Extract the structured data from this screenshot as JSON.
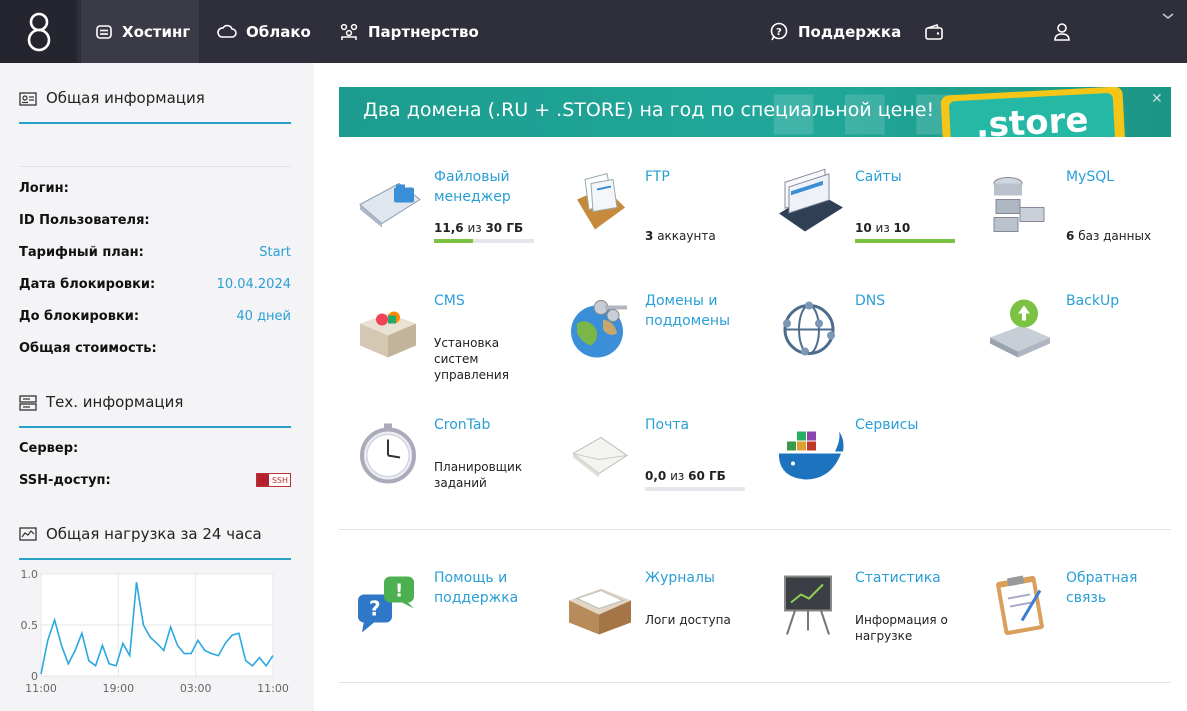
{
  "nav": {
    "items": [
      {
        "label": "Хостинг",
        "icon": "server-icon"
      },
      {
        "label": "Облако",
        "icon": "cloud-icon"
      },
      {
        "label": "Партнерство",
        "icon": "partners-icon"
      }
    ],
    "support_label": "Поддержка"
  },
  "general": {
    "title": "Общая информация",
    "rows": [
      {
        "label": "Логин:",
        "value": ""
      },
      {
        "label": "ID Пользователя:",
        "value": ""
      },
      {
        "label": "Тарифный план:",
        "value": "Start"
      },
      {
        "label": "Дата блокировки:",
        "value": "10.04.2024"
      },
      {
        "label": "До блокировки:",
        "value": "40 дней"
      },
      {
        "label": "Общая стоимость:",
        "value": ""
      }
    ]
  },
  "tech": {
    "title": "Тех. информация",
    "server_label": "Сервер:",
    "ssh_label": "SSH-доступ:",
    "ssh_badge": "SSH"
  },
  "load": {
    "title": "Общая нагрузка за 24 часа"
  },
  "chart_data": {
    "type": "line",
    "title": "Общая нагрузка за 24 часа",
    "x_tick_labels": [
      "11:00",
      "19:00",
      "03:00",
      "11:00"
    ],
    "y_tick_labels": [
      "0",
      "0.5",
      "1.0"
    ],
    "ylim": [
      0,
      1.0
    ],
    "grid": true,
    "color": "#29a9e0",
    "values": [
      0.02,
      0.35,
      0.55,
      0.3,
      0.12,
      0.25,
      0.42,
      0.15,
      0.1,
      0.3,
      0.12,
      0.1,
      0.32,
      0.2,
      0.92,
      0.5,
      0.38,
      0.32,
      0.25,
      0.48,
      0.3,
      0.22,
      0.22,
      0.35,
      0.25,
      0.22,
      0.2,
      0.32,
      0.4,
      0.42,
      0.15,
      0.1,
      0.18,
      0.1,
      0.2
    ]
  },
  "banner": {
    "text": "Два домена (.RU + .STORE) на год по специальной цене!",
    "store_label": ".store"
  },
  "tiles": [
    {
      "title": "Файловый менеджер",
      "used": "11,6",
      "of_word": "из",
      "total": "30 ГБ",
      "fill": 0.39,
      "icon": "file-manager-icon"
    },
    {
      "title": "FTP",
      "count": "3",
      "caption": "аккаунта",
      "icon": "ftp-icon"
    },
    {
      "title": "Сайты",
      "used": "10",
      "of_word": "из",
      "total": "10",
      "fill": 1.0,
      "icon": "sites-icon"
    },
    {
      "title": "MySQL",
      "count": "6",
      "caption": "баз данных",
      "icon": "mysql-icon"
    },
    {
      "title": "CMS",
      "caption": "Установка систем управления",
      "icon": "cms-box-icon"
    },
    {
      "title": "Домены и поддомены",
      "icon": "domains-globe-icon"
    },
    {
      "title": "DNS",
      "icon": "dns-network-icon"
    },
    {
      "title": "BackUp",
      "icon": "backup-drive-icon"
    },
    {
      "title": "CronTab",
      "caption": "Планировщик заданий",
      "icon": "clock-icon"
    },
    {
      "title": "Почта",
      "used": "0,0",
      "of_word": "из",
      "total": "60 ГБ",
      "fill": 0.0,
      "icon": "mail-envelope-icon"
    },
    {
      "title": "Сервисы",
      "icon": "docker-whale-icon"
    },
    {
      "title": "Помощь и поддержка",
      "icon": "help-bubbles-icon"
    },
    {
      "title": "Журналы",
      "caption": "Логи доступа",
      "icon": "logs-box-icon"
    },
    {
      "title": "Статистика",
      "caption": "Информация о нагрузке",
      "icon": "stats-board-icon"
    },
    {
      "title": "Обратная связь",
      "icon": "feedback-clipboard-icon"
    }
  ]
}
